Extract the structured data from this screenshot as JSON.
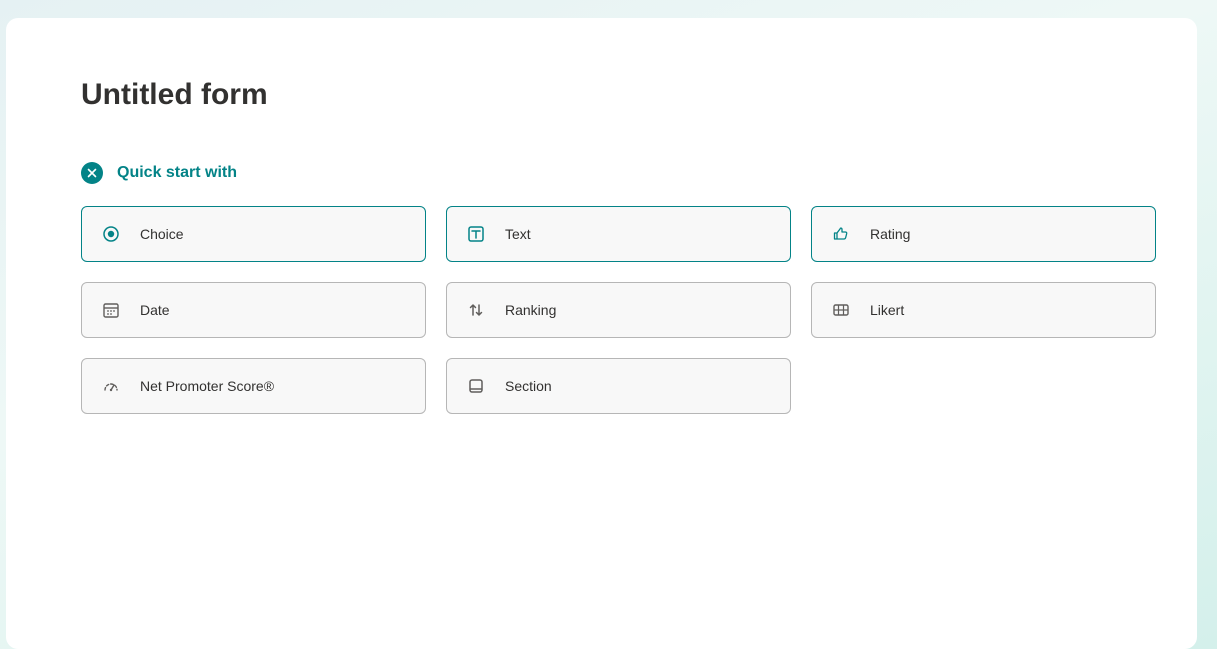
{
  "form": {
    "title": "Untitled form",
    "quick_start_label": "Quick start with"
  },
  "options": [
    {
      "id": "choice",
      "label": "Choice",
      "icon": "radio-icon",
      "teal_border": true,
      "teal_icon": true
    },
    {
      "id": "text",
      "label": "Text",
      "icon": "text-icon",
      "teal_border": true,
      "teal_icon": true
    },
    {
      "id": "rating",
      "label": "Rating",
      "icon": "thumb-icon",
      "teal_border": true,
      "teal_icon": true
    },
    {
      "id": "date",
      "label": "Date",
      "icon": "calendar-icon",
      "teal_border": false,
      "teal_icon": false
    },
    {
      "id": "ranking",
      "label": "Ranking",
      "icon": "updown-icon",
      "teal_border": false,
      "teal_icon": false
    },
    {
      "id": "likert",
      "label": "Likert",
      "icon": "grid-icon",
      "teal_border": false,
      "teal_icon": false
    },
    {
      "id": "nps",
      "label": "Net Promoter Score®",
      "icon": "gauge-icon",
      "teal_border": false,
      "teal_icon": false
    },
    {
      "id": "section",
      "label": "Section",
      "icon": "section-icon",
      "teal_border": false,
      "teal_icon": false
    }
  ],
  "colors": {
    "teal": "#038387",
    "grey_border": "#b6b6b6",
    "bg_card": "#ffffff",
    "option_bg": "#f8f8f8",
    "text": "#323130"
  }
}
